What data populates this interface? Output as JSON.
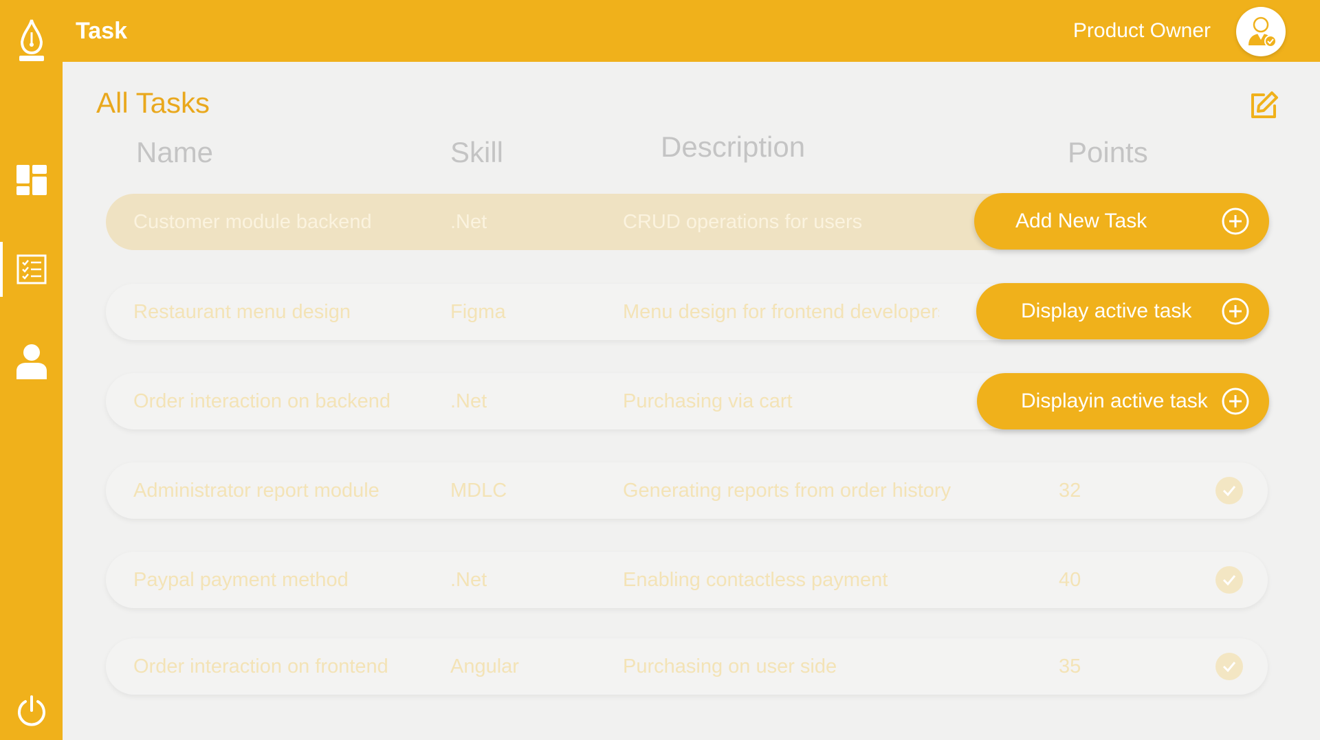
{
  "header": {
    "title": "Task",
    "role": "Product Owner"
  },
  "sidebar": {
    "icons": [
      "pen-logo-icon",
      "dashboard-icon",
      "task-list-icon",
      "user-icon",
      "power-icon"
    ],
    "active": "task-list-icon"
  },
  "page": {
    "title": "All Tasks"
  },
  "table": {
    "columns": [
      "Name",
      "Skill",
      "Description",
      "Points"
    ],
    "rows": [
      {
        "name": "Customer module backend",
        "skill": ".Net",
        "description": "CRUD operations for users",
        "points": ""
      },
      {
        "name": "Restaurant menu design",
        "skill": "Figma",
        "description": "Menu design for frontend developers",
        "points": ""
      },
      {
        "name": "Order interaction on backend",
        "skill": ".Net",
        "description": "Purchasing via cart",
        "points": ""
      },
      {
        "name": "Administrator report module",
        "skill": "MDLC",
        "description": "Generating reports from order history",
        "points": "32"
      },
      {
        "name": "Paypal payment method",
        "skill": ".Net",
        "description": "Enabling contactless payment",
        "points": "40"
      },
      {
        "name": "Order interaction on frontend",
        "skill": "Angular",
        "description": "Purchasing on user side",
        "points": "35"
      }
    ]
  },
  "actions": {
    "add_task": "Add New Task",
    "display_active": "Display active task",
    "displayin_active": "Displayin active task"
  },
  "colors": {
    "brand": "#f0b11b",
    "title": "#e9a81d",
    "header_text": "#c4c4c4",
    "row_text": "#f3e3b6",
    "highlight_row": "#efe2c2"
  }
}
